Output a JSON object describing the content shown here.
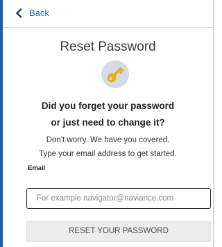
{
  "header": {
    "back_label": "Back",
    "back_icon": "chevron-left-icon"
  },
  "main": {
    "title": "Reset Password",
    "key_icon": "key-icon",
    "question_line1": "Did you forget your password",
    "question_line2": "or just need to change it?",
    "info_line1": "Don't worry. We have you covered.",
    "info_line2": "Type your email address to get started."
  },
  "form": {
    "email_label": "Email",
    "email_value": "",
    "email_placeholder": "For example navigator@naviance.com",
    "submit_label": "RESET YOUR PASSWORD"
  },
  "colors": {
    "accent": "#1e5fa8",
    "link": "#1f6fb8",
    "key": "#f0a81c",
    "key_circle": "#d3dde7",
    "button_bg": "#ececec"
  }
}
